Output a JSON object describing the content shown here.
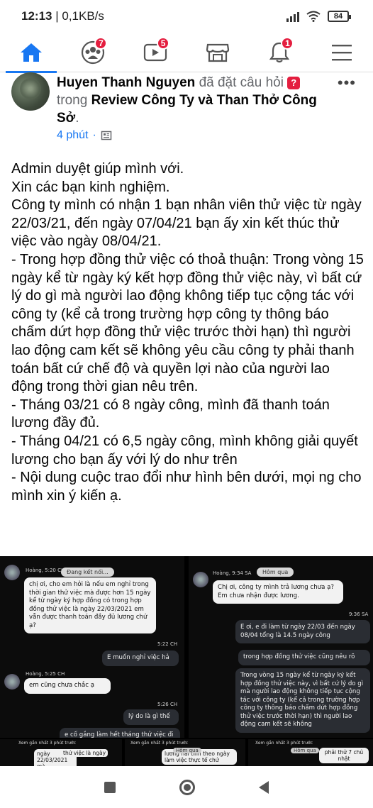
{
  "status_bar": {
    "time": "12:13",
    "network_speed": "0,1KB/s",
    "battery": "84"
  },
  "nav": {
    "items": [
      {
        "name": "home",
        "badge": ""
      },
      {
        "name": "groups",
        "badge": "7"
      },
      {
        "name": "watch",
        "badge": "5"
      },
      {
        "name": "marketplace",
        "badge": ""
      },
      {
        "name": "notifications",
        "badge": "1"
      },
      {
        "name": "menu",
        "badge": ""
      }
    ]
  },
  "post": {
    "author": "Huyen Thanh Nguyen",
    "action": "đã đặt câu hỏi",
    "in_word": "trong",
    "group": "Review Công Ty và Than Thở Công Sở",
    "time": "4 phút",
    "body": [
      "Admin duyệt giúp mình với.",
      "Xin các bạn kinh nghiệm.",
      "Công ty mình có nhận 1 bạn nhân viên thử việc từ ngày 22/03/21, đến ngày 07/04/21 bạn ấy xin kết thúc thử việc vào ngày 08/04/21.",
      "- Trong hợp đồng thử việc có thoả thuận: Trong vòng 15 ngày kể từ ngày ký kết hợp đồng thử việc này, vì bất cứ lý do gì mà người lao động không tiếp tục cộng tác với công ty (kể cả trong trường hợp công ty thông báo chấm dứt hợp đồng thử việc trước thời hạn) thì người lao động cam kết sẽ không yêu cầu công ty phải thanh toán bất cứ chế độ và quyền lợi nào của người lao động trong thời gian nêu trên.",
      "- Tháng 03/21 có 8 ngày công, mình đã thanh toán lương đầy đủ.",
      "- Tháng 04/21 có 6,5 ngày công, mình không giải quyết lương cho bạn ấy với lý do như trên",
      "- Nội dung cuộc trao đổi như hình bên dưới, mọi ng cho mình xin ý kiến ạ."
    ]
  },
  "chat_left": {
    "top_left": "Hoàng, 5:20 CH",
    "connecting": "Đang kết nối...",
    "msg1": "chị ơi, cho em hỏi là nếu em nghỉ trong thời gian thử việc mà được hơn 15 ngày kể từ ngày ký hợp đồng có trong hợp đồng thử việc là ngày 22/03/2021 em vẫn được thanh toán đầy đủ lương chứ ạ?",
    "time1": "5:22 CH",
    "reply1": "E muốn nghỉ việc hả",
    "sender2": "Hoàng, 5:25 CH",
    "msg2": "em cũng chưa chắc ạ",
    "time2": "5:26 CH",
    "reply2": "lý do là gì thế",
    "reply3": "e cố gắng làm hết tháng thử việc đi"
  },
  "chat_right": {
    "sender": "Hoàng, 9:34 SA",
    "pill": "Hôm qua",
    "msg1": "Chị ơi, công ty mình trả lương chưa ạ? Em chưa nhận được lương.",
    "time1": "9:36 SA",
    "reply1": "E ơi, e đi làm từ ngày 22/03 đến ngày 08/04 tổng là 14.5 ngày công",
    "reply2": "trong hợp đồng thử việc cũng nêu rõ",
    "reply3": "Trong vòng 15 ngày kể từ ngày ký kết hợp đồng thử việc này, vì bất cứ lý do gì mà người lao động không tiếp tục cộng tác với công ty (kể cả trong trường hợp công ty thông báo chấm dứt hợp đồng thử việc trước thời hạn) thì người lao động cam kết sẽ không"
  },
  "strip": {
    "s1_top": "Xem gần nhất 3 phút trước",
    "s1_msg": "ngày 22/03/2021 mà",
    "s1_msg2": "thử việc là ngày",
    "s2_top": "Xem gần nhất 3 phút trước",
    "s2_pill": "Hôm qua",
    "s2_msg": "lương hải tính theo ngày làm việc thực tế chứ",
    "s3_top": "Xem gần nhất 3 phút trước",
    "s3_pill": "Hôm qua",
    "s3_msg": "phải thử 7 chủ nhật"
  }
}
